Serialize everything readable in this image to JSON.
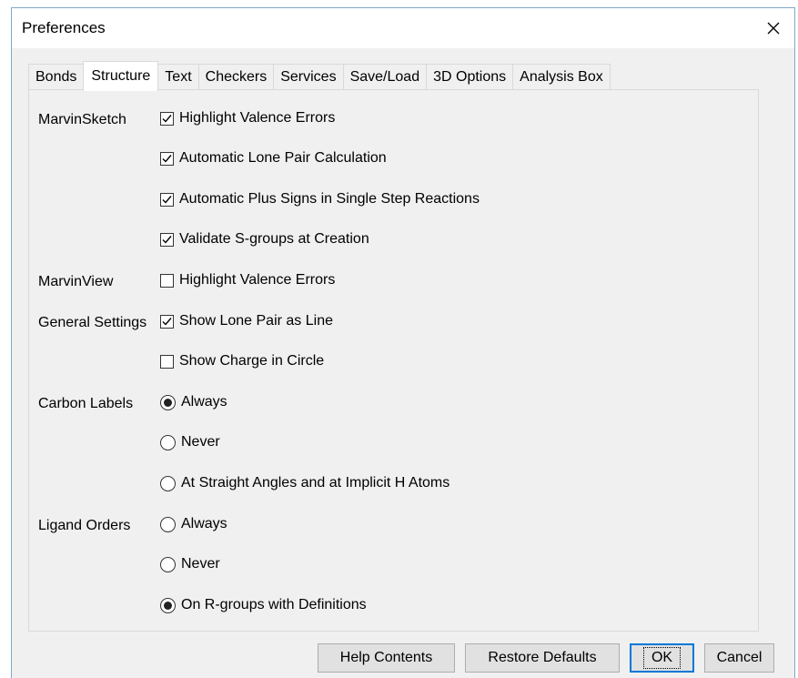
{
  "window": {
    "title": "Preferences"
  },
  "tabs": [
    {
      "label": "Bonds",
      "active": false
    },
    {
      "label": "Structure",
      "active": true
    },
    {
      "label": "Text",
      "active": false
    },
    {
      "label": "Checkers",
      "active": false
    },
    {
      "label": "Services",
      "active": false
    },
    {
      "label": "Save/Load",
      "active": false
    },
    {
      "label": "3D Options",
      "active": false
    },
    {
      "label": "Analysis Box",
      "active": false
    }
  ],
  "groups": {
    "marvinsketch": "MarvinSketch",
    "marvinview": "MarvinView",
    "general": "General Settings",
    "carbon": "Carbon Labels",
    "ligand": "Ligand Orders"
  },
  "options": {
    "ms_highlight_valence": {
      "label": "Highlight Valence Errors",
      "checked": true
    },
    "ms_auto_lone_pair": {
      "label": "Automatic Lone Pair Calculation",
      "checked": true
    },
    "ms_auto_plus_signs": {
      "label": "Automatic Plus Signs in Single Step Reactions",
      "checked": true
    },
    "ms_validate_sgroups": {
      "label": "Validate S-groups at Creation",
      "checked": true
    },
    "mv_highlight_valence": {
      "label": "Highlight Valence Errors",
      "checked": false
    },
    "gs_lone_pair_line": {
      "label": "Show Lone Pair as Line",
      "checked": true
    },
    "gs_charge_circle": {
      "label": "Show Charge in Circle",
      "checked": false
    },
    "cl_always": {
      "label": "Always",
      "selected": true
    },
    "cl_never": {
      "label": "Never",
      "selected": false
    },
    "cl_straight": {
      "label": "At Straight Angles and at Implicit H Atoms",
      "selected": false
    },
    "lo_always": {
      "label": "Always",
      "selected": false
    },
    "lo_never": {
      "label": "Never",
      "selected": false
    },
    "lo_rgroups": {
      "label": "On R-groups with Definitions",
      "selected": true
    }
  },
  "buttons": {
    "help": "Help Contents",
    "restore": "Restore Defaults",
    "ok": "OK",
    "cancel": "Cancel"
  }
}
